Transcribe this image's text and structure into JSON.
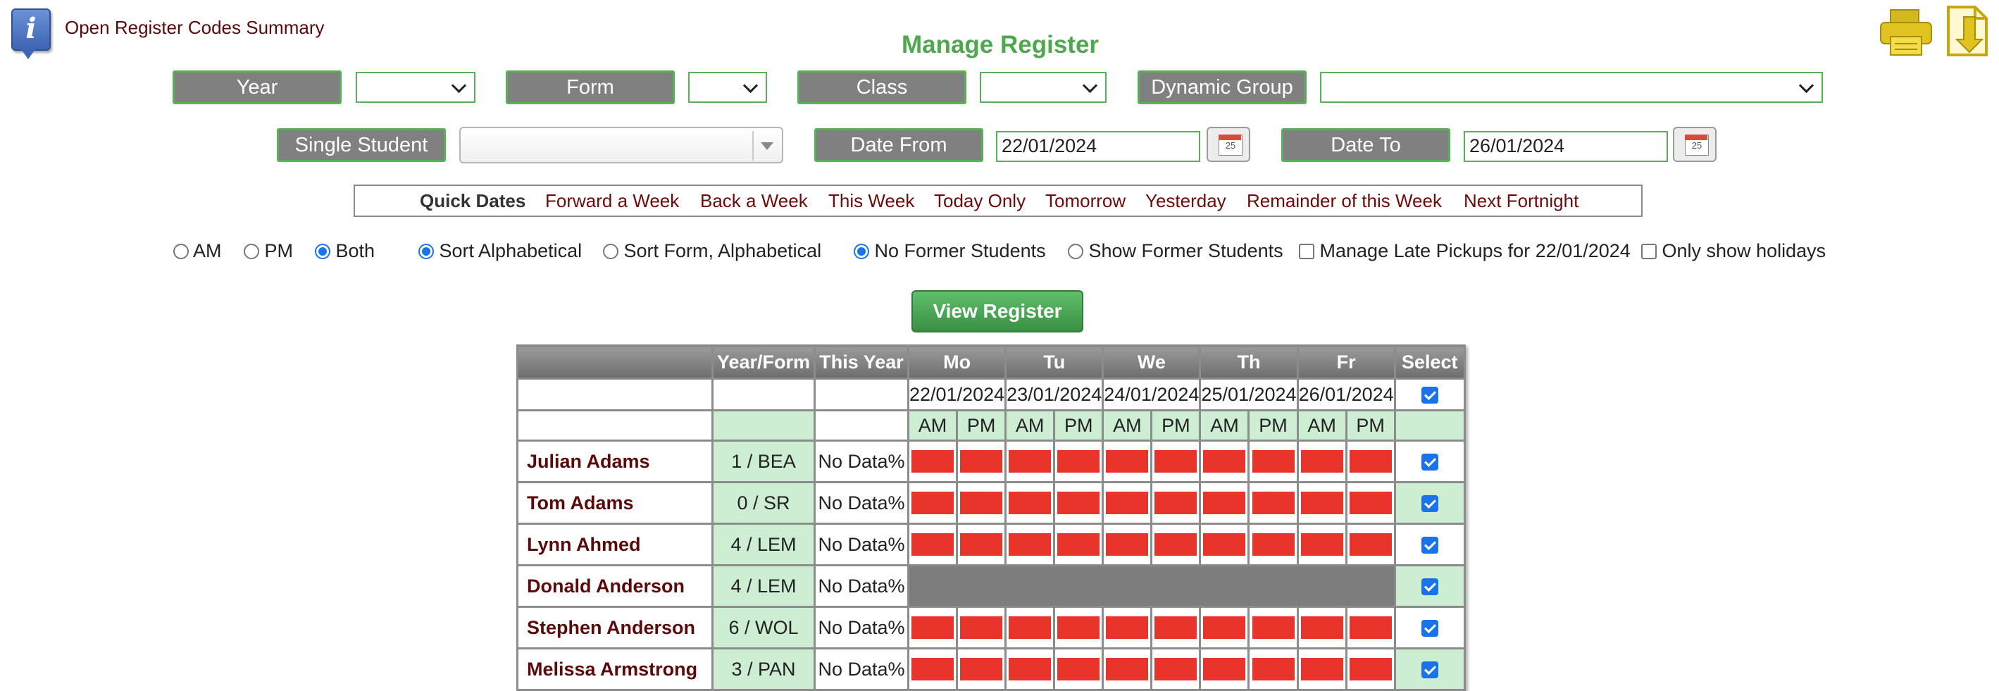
{
  "header": {
    "info_icon_letter": "i",
    "open_codes_link": "Open Register Codes Summary",
    "title": "Manage Register"
  },
  "filters": {
    "year_label": "Year",
    "form_label": "Form",
    "class_label": "Class",
    "dynamic_group_label": "Dynamic Group",
    "single_student_label": "Single Student",
    "date_from_label": "Date From",
    "date_from_value": "22/01/2024",
    "date_to_label": "Date To",
    "date_to_value": "26/01/2024",
    "calendar_icon_day": "25"
  },
  "quick_dates": {
    "title": "Quick Dates",
    "links": [
      "Forward a Week",
      "Back a Week",
      "This Week",
      "Today Only",
      "Tomorrow",
      "Yesterday",
      "Remainder of this Week",
      "Next Fortnight"
    ]
  },
  "options": {
    "am": "AM",
    "pm": "PM",
    "both": "Both",
    "sort_alpha": "Sort Alphabetical",
    "sort_form": "Sort Form, Alphabetical",
    "no_former": "No Former Students",
    "show_former": "Show Former Students",
    "late_pickups": "Manage Late Pickups for 22/01/2024",
    "only_holidays": "Only show holidays"
  },
  "view_button": "View Register",
  "register": {
    "headers": {
      "year_form": "Year/Form",
      "this_year": "This Year",
      "days": [
        "Mo",
        "Tu",
        "We",
        "Th",
        "Fr"
      ],
      "select": "Select"
    },
    "dates": [
      "22/01/2024",
      "23/01/2024",
      "24/01/2024",
      "25/01/2024",
      "26/01/2024"
    ],
    "am": "AM",
    "pm": "PM",
    "students": [
      {
        "name": "Julian Adams",
        "year_form": "1 / BEA",
        "this_year": "No Data%"
      },
      {
        "name": "Tom Adams",
        "year_form": "0 / SR",
        "this_year": "No Data%"
      },
      {
        "name": "Lynn Ahmed",
        "year_form": "4 / LEM",
        "this_year": "No Data%"
      },
      {
        "name": "Donald Anderson",
        "year_form": "4 / LEM",
        "this_year": "No Data%"
      },
      {
        "name": "Stephen Anderson",
        "year_form": "6 / WOL",
        "this_year": "No Data%"
      },
      {
        "name": "Melissa Armstrong",
        "year_form": "3 / PAN",
        "this_year": "No Data%"
      }
    ]
  },
  "colors": {
    "accent_green": "#58b058",
    "title_green": "#4ea84e",
    "link_maroon": "#6a0c0c",
    "absent_red": "#e8342a",
    "row_green": "#cdeed2"
  }
}
